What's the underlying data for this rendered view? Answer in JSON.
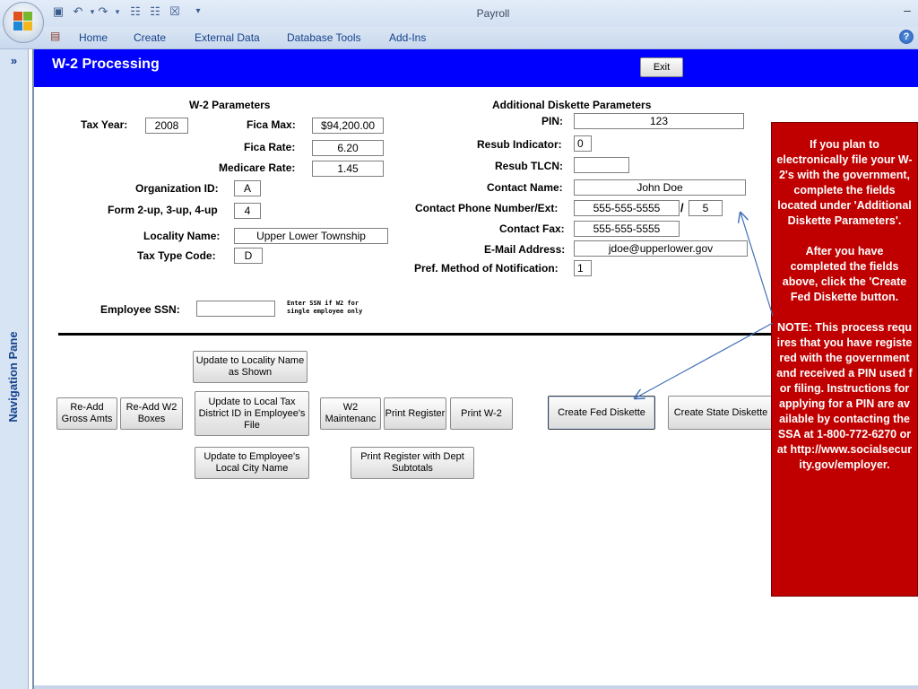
{
  "window": {
    "app_title": "Payroll",
    "minimize_glyph": "–"
  },
  "ribbon": {
    "tabs": [
      "Home",
      "Create",
      "External Data",
      "Database Tools",
      "Add-Ins"
    ],
    "help_glyph": "?"
  },
  "nav_pane": {
    "toggle_glyph": "»",
    "label": "Navigation Pane"
  },
  "form": {
    "title": "W-2 Processing",
    "exit_label": "Exit",
    "w2_params": {
      "title": "W-2 Parameters",
      "tax_year_label": "Tax Year:",
      "tax_year": "2008",
      "fica_max_label": "Fica Max:",
      "fica_max": "$94,200.00",
      "fica_rate_label": "Fica Rate:",
      "fica_rate": "6.20",
      "medicare_rate_label": "Medicare Rate:",
      "medicare_rate": "1.45",
      "org_id_label": "Organization ID:",
      "org_id": "A",
      "form_up_label": "Form 2-up, 3-up, 4-up",
      "form_up": "4",
      "locality_name_label": "Locality Name:",
      "locality_name": "Upper Lower Township",
      "tax_type_label": "Tax Type Code:",
      "tax_type": "D"
    },
    "diskette_params": {
      "title": "Additional Diskette Parameters",
      "pin_label": "PIN:",
      "pin": "123",
      "resub_indicator_label": "Resub Indicator:",
      "resub_indicator": "0",
      "resub_tlcn_label": "Resub TLCN:",
      "resub_tlcn": "",
      "contact_name_label": "Contact Name:",
      "contact_name": "John Doe",
      "contact_phone_label": "Contact Phone Number/Ext:",
      "contact_phone": "555-555-5555",
      "phone_sep": "/",
      "contact_ext": "5",
      "contact_fax_label": "Contact Fax:",
      "contact_fax": "555-555-5555",
      "email_label": "E-Mail Address:",
      "email": "jdoe@upperlower.gov",
      "pref_method_label": "Pref. Method of Notification:",
      "pref_method": "1"
    },
    "employee_ssn_label": "Employee SSN:",
    "employee_ssn": "",
    "ssn_note_line1": "Enter SSN if W2 for",
    "ssn_note_line2": "single employee only",
    "buttons": {
      "update_locality_name": "Update to Locality Name as Shown",
      "readd_gross": "Re-Add Gross Amts",
      "readd_w2": "Re-Add W2 Boxes",
      "update_local_tax": "Update to Local Tax District ID in Employee's File",
      "w2_maint": "W2 Maintenanc",
      "print_register": "Print Register",
      "print_w2": "Print W-2",
      "create_fed": "Create Fed Diskette",
      "create_state": "Create State Diskette",
      "update_city": "Update to Employee's Local City Name",
      "print_register_dept": "Print Register with Dept Subtotals"
    }
  },
  "callout": {
    "para1": "If you plan to electronically  file your W-2's with the government, complete the fields located under 'Additional Diskette Parameters'.",
    "para2": "After you have completed the fields above, click the 'Create Fed Diskette button.",
    "para3": "NOTE: This process requires that you have registered with the government and received a PIN used for filing. Instructions for applying for a PIN are available by contacting the SSA at 1-800-772-6270 or at http://www.socialsecurity.gov/employer.",
    "color": "#c00000"
  },
  "colors": {
    "form_header": "#0000ff",
    "ribbon_text": "#15428b"
  }
}
